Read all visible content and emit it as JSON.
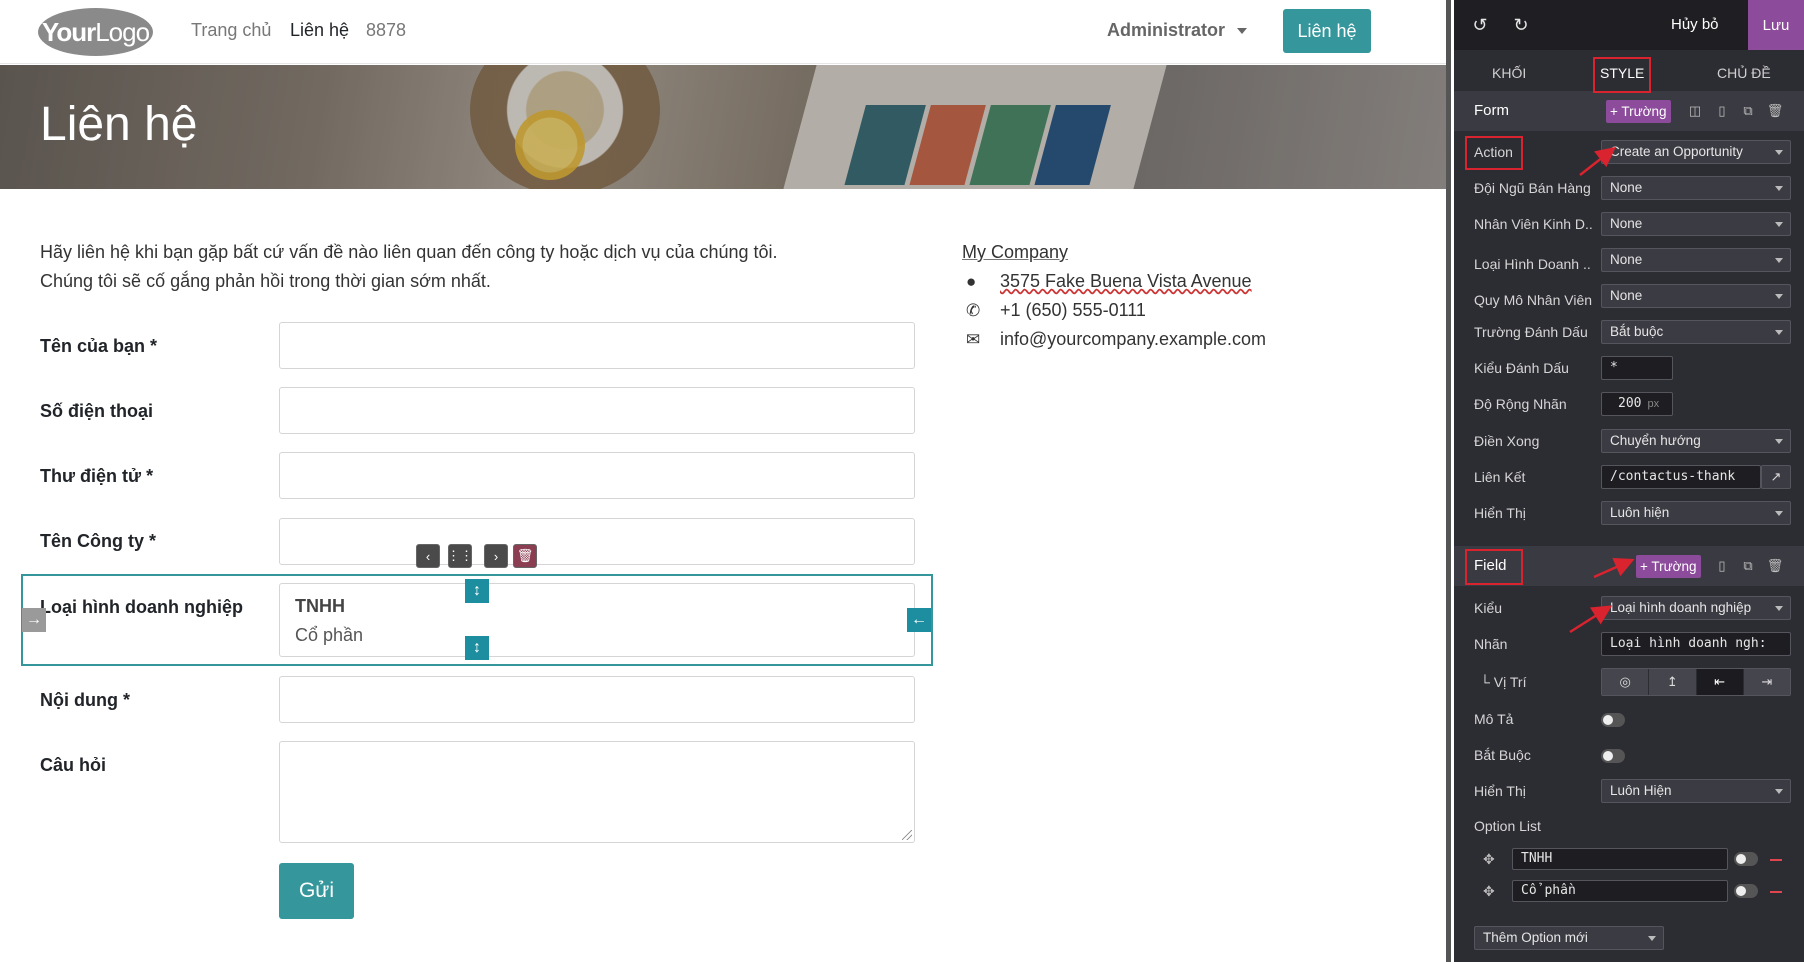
{
  "site": {
    "logo": {
      "bold": "Your",
      "thin": "Logo"
    },
    "nav": [
      "Trang chủ",
      "Liên hệ",
      "8878"
    ],
    "admin": "Administrator",
    "cta": "Liên hệ",
    "hero_title": "Liên hệ",
    "intro": [
      "Hãy liên hệ khi bạn gặp bất cứ vấn đề nào liên quan đến công ty hoặc dịch vụ của chúng tôi.",
      "Chúng tôi sẽ cố gắng phản hồi trong thời gian sớm nhất."
    ],
    "form": {
      "name_label": "Tên của bạn",
      "phone_label": "Số điện thoại",
      "email_label": "Thư điện tử",
      "company_label": "Tên Công ty",
      "business_type_label": "Loại hình doanh nghiệp",
      "business_type_options": [
        "TNHH",
        "Cổ phần"
      ],
      "content_label": "Nội dung",
      "question_label": "Câu hỏi",
      "required_mark": "*",
      "submit": "Gửi"
    },
    "company": {
      "name": "My Company",
      "address": "3575 Fake Buena Vista Avenue",
      "phone": "+1 (650) 555-0111",
      "email": "info@yourcompany.example.com"
    }
  },
  "panel": {
    "cancel": "Hủy bỏ",
    "save": "Lưu",
    "tabs": [
      "KHỐI",
      "STYLE",
      "CHỦ ĐỀ"
    ],
    "form_section": {
      "title": "Form",
      "add_field": "+ Trường",
      "rows": {
        "action": {
          "label": "Action",
          "value": "Create an Opportunity"
        },
        "sales_team": {
          "label": "Đội Ngũ Bán Hàng",
          "value": "None"
        },
        "salesperson": {
          "label": "Nhân Viên Kinh D...",
          "value": "None"
        },
        "business_type": {
          "label": "Loại Hình Doanh ...",
          "value": "None"
        },
        "company_size": {
          "label": "Quy Mô Nhân Viên",
          "value": "None"
        },
        "marked_field": {
          "label": "Trường Đánh Dấu",
          "value": "Bắt buộc"
        },
        "mark_style": {
          "label": "Kiểu Đánh Dấu",
          "value": "*"
        },
        "label_width": {
          "label": "Độ Rộng Nhãn",
          "value": "200",
          "unit": "px"
        },
        "on_success": {
          "label": "Điền Xong",
          "value": "Chuyển hướng"
        },
        "link": {
          "label": "Liên Kết",
          "value": "/contactus-thank"
        },
        "visibility": {
          "label": "Hiển Thị",
          "value": "Luôn hiện"
        }
      }
    },
    "field_section": {
      "title": "Field",
      "add_field": "+ Trường",
      "type": {
        "label": "Kiểu",
        "value": "Loại hình doanh nghiệp"
      },
      "label": {
        "label": "Nhãn",
        "value": "Loại hình doanh ngh:"
      },
      "position": {
        "label": "└ Vị Trí"
      },
      "description": {
        "label": "Mô Tả"
      },
      "required": {
        "label": "Bắt Buộc"
      },
      "visibility": {
        "label": "Hiển Thị",
        "value": "Luôn Hiện"
      },
      "option_list": {
        "label": "Option List",
        "options": [
          "TNHH",
          "Cổ phần"
        ]
      },
      "add_option": "Thêm Option mới"
    }
  },
  "colors": {
    "accent": "#35979c",
    "editor_purple": "#8c4b9b",
    "annotation_red": "#d9232e",
    "panel_bg": "#2c2c33"
  }
}
